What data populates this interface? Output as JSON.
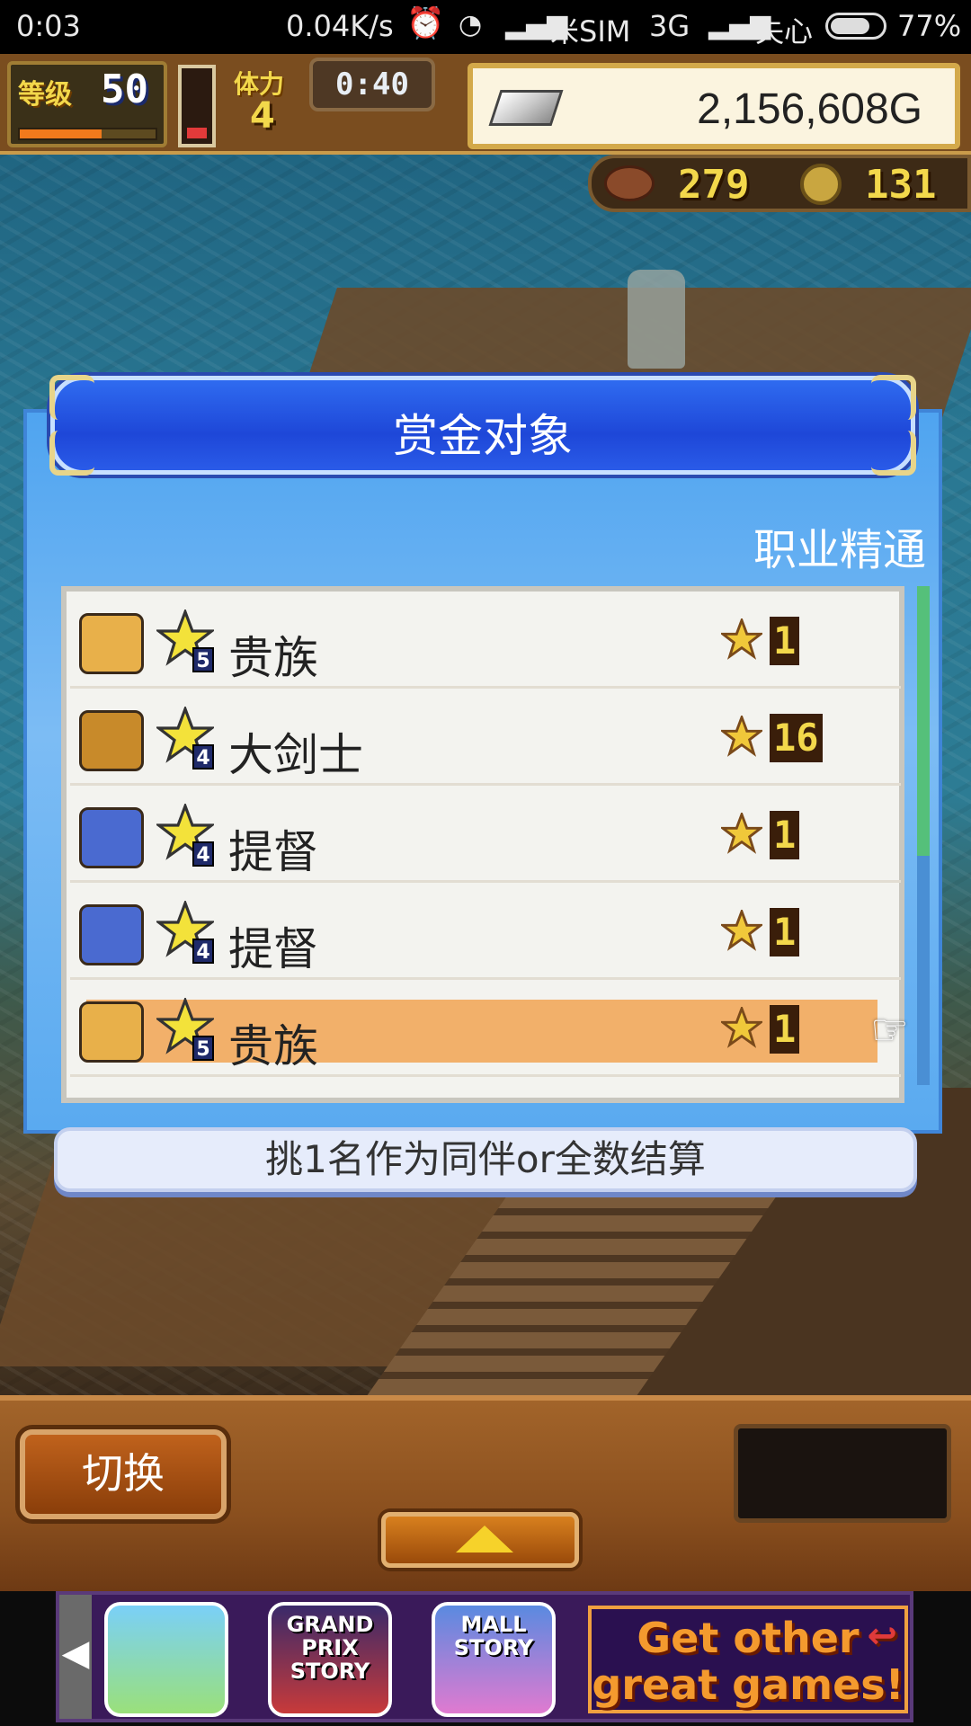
{
  "status_bar": {
    "time": "0:03",
    "net_speed": "0.04K/s",
    "carrier1": "米SIM",
    "network": "3G",
    "carrier2": "失心",
    "battery": "77%"
  },
  "hud": {
    "level_label": "等级",
    "level_value": "50",
    "stamina_label": "体力",
    "stamina_value": "4",
    "timer": "0:40",
    "money": "2,156,608G",
    "meat_count": "279",
    "coin_count": "131"
  },
  "dialog": {
    "title": "赏金对象",
    "tab_label": "职业精通",
    "rows": [
      {
        "job": "贵族",
        "rank": "5",
        "count": "1",
        "selected": false,
        "avatar_color": "#e8b04a"
      },
      {
        "job": "大剑士",
        "rank": "4",
        "count": "16",
        "selected": false,
        "avatar_color": "#c88a2a"
      },
      {
        "job": "提督",
        "rank": "4",
        "count": "1",
        "selected": false,
        "avatar_color": "#4a6ad0"
      },
      {
        "job": "提督",
        "rank": "4",
        "count": "1",
        "selected": false,
        "avatar_color": "#4a6ad0"
      },
      {
        "job": "贵族",
        "rank": "5",
        "count": "1",
        "selected": true,
        "avatar_color": "#e8b04a"
      }
    ],
    "hint": "挑1名作为同伴or全数结算"
  },
  "bottom_bar": {
    "switch_label": "切换"
  },
  "ad_banner": {
    "games": [
      {
        "name": "GRAND PRIX STORY"
      },
      {
        "name": "MALL STORY"
      }
    ],
    "cta": "Get other great games!"
  },
  "colors": {
    "dialog_blue": "#4fa4f0",
    "header_blue": "#1e47d8",
    "selected_row": "#f2b06a",
    "gold_text": "#f3d84b"
  }
}
